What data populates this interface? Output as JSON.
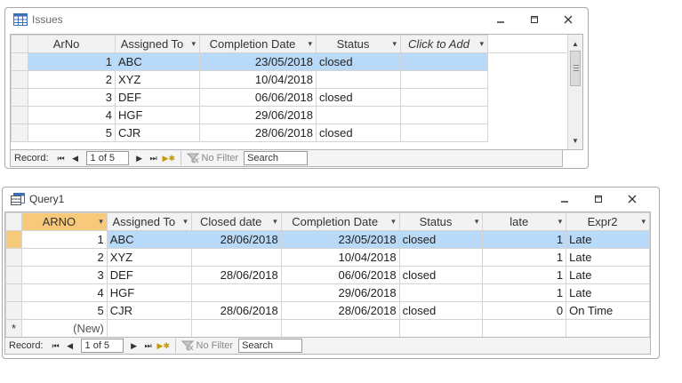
{
  "issues_window": {
    "title": "Issues",
    "columns": [
      "ArNo",
      "Assigned To",
      "Completion Date",
      "Status",
      "Click to Add"
    ],
    "rows": [
      {
        "arno": "1",
        "assigned": "ABC",
        "completion": "23/05/2018",
        "status": "closed"
      },
      {
        "arno": "2",
        "assigned": "XYZ",
        "completion": "10/04/2018",
        "status": ""
      },
      {
        "arno": "3",
        "assigned": "DEF",
        "completion": "06/06/2018",
        "status": "closed"
      },
      {
        "arno": "4",
        "assigned": "HGF",
        "completion": "29/06/2018",
        "status": ""
      },
      {
        "arno": "5",
        "assigned": "CJR",
        "completion": "28/06/2018",
        "status": "closed"
      }
    ],
    "nav": {
      "record_label": "Record:",
      "position": "1 of 5",
      "filter": "No Filter",
      "search": "Search"
    }
  },
  "query_window": {
    "title": "Query1",
    "columns": [
      "ARNO",
      "Assigned To",
      "Closed date",
      "Completion Date",
      "Status",
      "late",
      "Expr2"
    ],
    "rows": [
      {
        "arno": "1",
        "assigned": "ABC",
        "closed": "28/06/2018",
        "completion": "23/05/2018",
        "status": "closed",
        "late": "1",
        "expr2": "Late"
      },
      {
        "arno": "2",
        "assigned": "XYZ",
        "closed": "",
        "completion": "10/04/2018",
        "status": "",
        "late": "1",
        "expr2": "Late"
      },
      {
        "arno": "3",
        "assigned": "DEF",
        "closed": "28/06/2018",
        "completion": "06/06/2018",
        "status": "closed",
        "late": "1",
        "expr2": "Late"
      },
      {
        "arno": "4",
        "assigned": "HGF",
        "closed": "",
        "completion": "29/06/2018",
        "status": "",
        "late": "1",
        "expr2": "Late"
      },
      {
        "arno": "5",
        "assigned": "CJR",
        "closed": "28/06/2018",
        "completion": "28/06/2018",
        "status": "closed",
        "late": "0",
        "expr2": "On Time"
      }
    ],
    "new_row": {
      "marker": "*",
      "label": "(New)"
    },
    "nav": {
      "record_label": "Record:",
      "position": "1 of 5",
      "filter": "No Filter",
      "search": "Search"
    }
  },
  "colors": {
    "selected_row": "#b9d9f8",
    "selected_header": "#f7c97a"
  },
  "icons": [
    "table-icon",
    "query-icon",
    "minimize-icon",
    "restore-icon",
    "close-icon",
    "filter-icon"
  ]
}
